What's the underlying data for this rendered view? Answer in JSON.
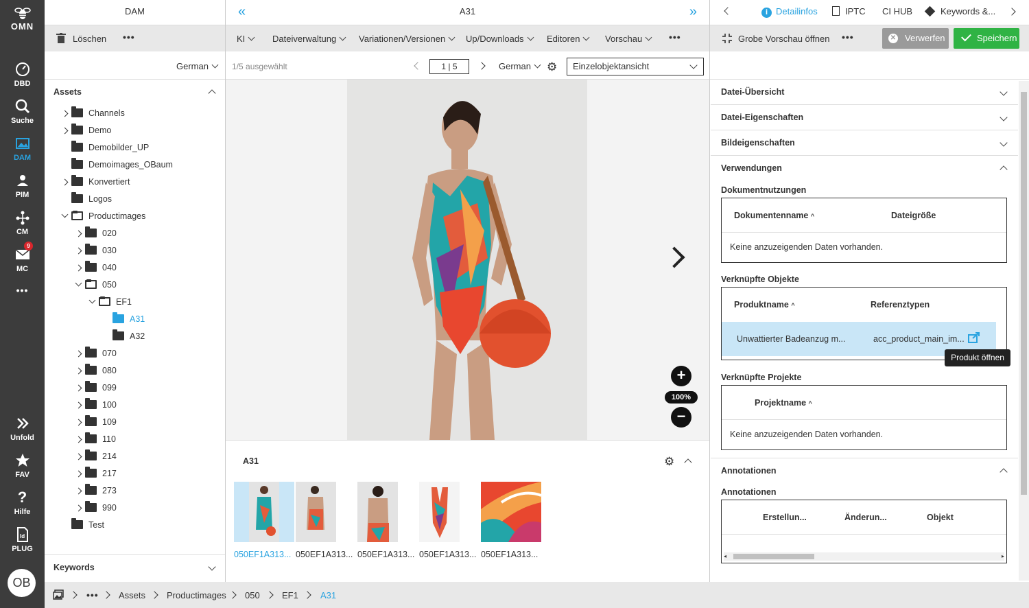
{
  "nav": {
    "logo": "OMN",
    "items": [
      {
        "label": "DBD",
        "icon": "dashboard-icon"
      },
      {
        "label": "Suche",
        "icon": "search-icon"
      },
      {
        "label": "DAM",
        "icon": "dam-icon"
      },
      {
        "label": "PIM",
        "icon": "pim-icon"
      },
      {
        "label": "CM",
        "icon": "cm-icon"
      },
      {
        "label": "MC",
        "icon": "mail-icon",
        "badge": "9"
      },
      {
        "label": "Unfold",
        "icon": "unfold-icon"
      },
      {
        "label": "FAV",
        "icon": "star-icon"
      },
      {
        "label": "Hilfe",
        "icon": "help-icon"
      },
      {
        "label": "PLUG",
        "icon": "plugin-icon"
      }
    ],
    "avatar": "OB"
  },
  "left": {
    "title": "DAM",
    "delete_label": "Löschen",
    "language": "German",
    "assets_label": "Assets",
    "keywords_label": "Keywords",
    "tree": [
      {
        "label": "Channels"
      },
      {
        "label": "Demo"
      },
      {
        "label": "Demobilder_UP"
      },
      {
        "label": "Demoimages_OBaum"
      },
      {
        "label": "Konvertiert"
      },
      {
        "label": "Logos"
      },
      {
        "label": "Productimages"
      },
      {
        "label": "020"
      },
      {
        "label": "030"
      },
      {
        "label": "040"
      },
      {
        "label": "050"
      },
      {
        "label": "EF1"
      },
      {
        "label": "A31"
      },
      {
        "label": "A32"
      },
      {
        "label": "070"
      },
      {
        "label": "080"
      },
      {
        "label": "099"
      },
      {
        "label": "100"
      },
      {
        "label": "109"
      },
      {
        "label": "110"
      },
      {
        "label": "214"
      },
      {
        "label": "217"
      },
      {
        "label": "273"
      },
      {
        "label": "990"
      },
      {
        "label": "Test"
      }
    ]
  },
  "center": {
    "title": "A31",
    "toolbar": [
      "KI",
      "Dateiverwaltung",
      "Variationen/Versionen",
      "Up/Downloads",
      "Editoren",
      "Vorschau"
    ],
    "selected_count": "1/5 ausgewählt",
    "page_indicator": "1 | 5",
    "language": "German",
    "view_mode": "Einzelobjektansicht",
    "zoom": "100%",
    "strip_title": "A31",
    "thumbnails": [
      "050EF1A313...",
      "050EF1A313...",
      "050EF1A313...",
      "050EF1A313...",
      "050EF1A313..."
    ]
  },
  "right": {
    "tabs": [
      "Detailinfos",
      "IPTC",
      "CI HUB",
      "Keywords &..."
    ],
    "preview_label": "Grobe Vorschau öffnen",
    "discard_label": "Verwerfen",
    "save_label": "Speichern",
    "sections": {
      "file_overview": "Datei-Übersicht",
      "file_props": "Datei-Eigenschaften",
      "image_props": "Bildeigenschaften",
      "usages": "Verwendungen",
      "annotations": "Annotationen"
    },
    "doc_usage": {
      "title": "Dokumentnutzungen",
      "col1": "Dokumentenname",
      "col2": "Dateigröße",
      "empty": "Keine anzuzeigenden Daten vorhanden."
    },
    "linked_objects": {
      "title": "Verknüpfte Objekte",
      "col1": "Produktname",
      "col2": "Referenztypen",
      "row_name": "Unwattierter Badeanzug m...",
      "row_ref": "acc_product_main_im...",
      "tooltip": "Produkt öffnen"
    },
    "linked_projects": {
      "title": "Verknüpfte Projekte",
      "col1": "Projektname",
      "empty": "Keine anzuzeigenden Daten vorhanden."
    },
    "annotations_table": {
      "title": "Annotationen",
      "cols": [
        "Erstellun...",
        "Änderun...",
        "Objekt"
      ]
    }
  },
  "breadcrumb": [
    "Assets",
    "Productimages",
    "050",
    "EF1",
    "A31"
  ],
  "colors": {
    "accent": "#29a3e0",
    "nav_bg": "#3c3c3c",
    "save_green": "#2fb344",
    "discard_gray": "#9a9a9a",
    "selected_row": "#c9e6f7"
  }
}
